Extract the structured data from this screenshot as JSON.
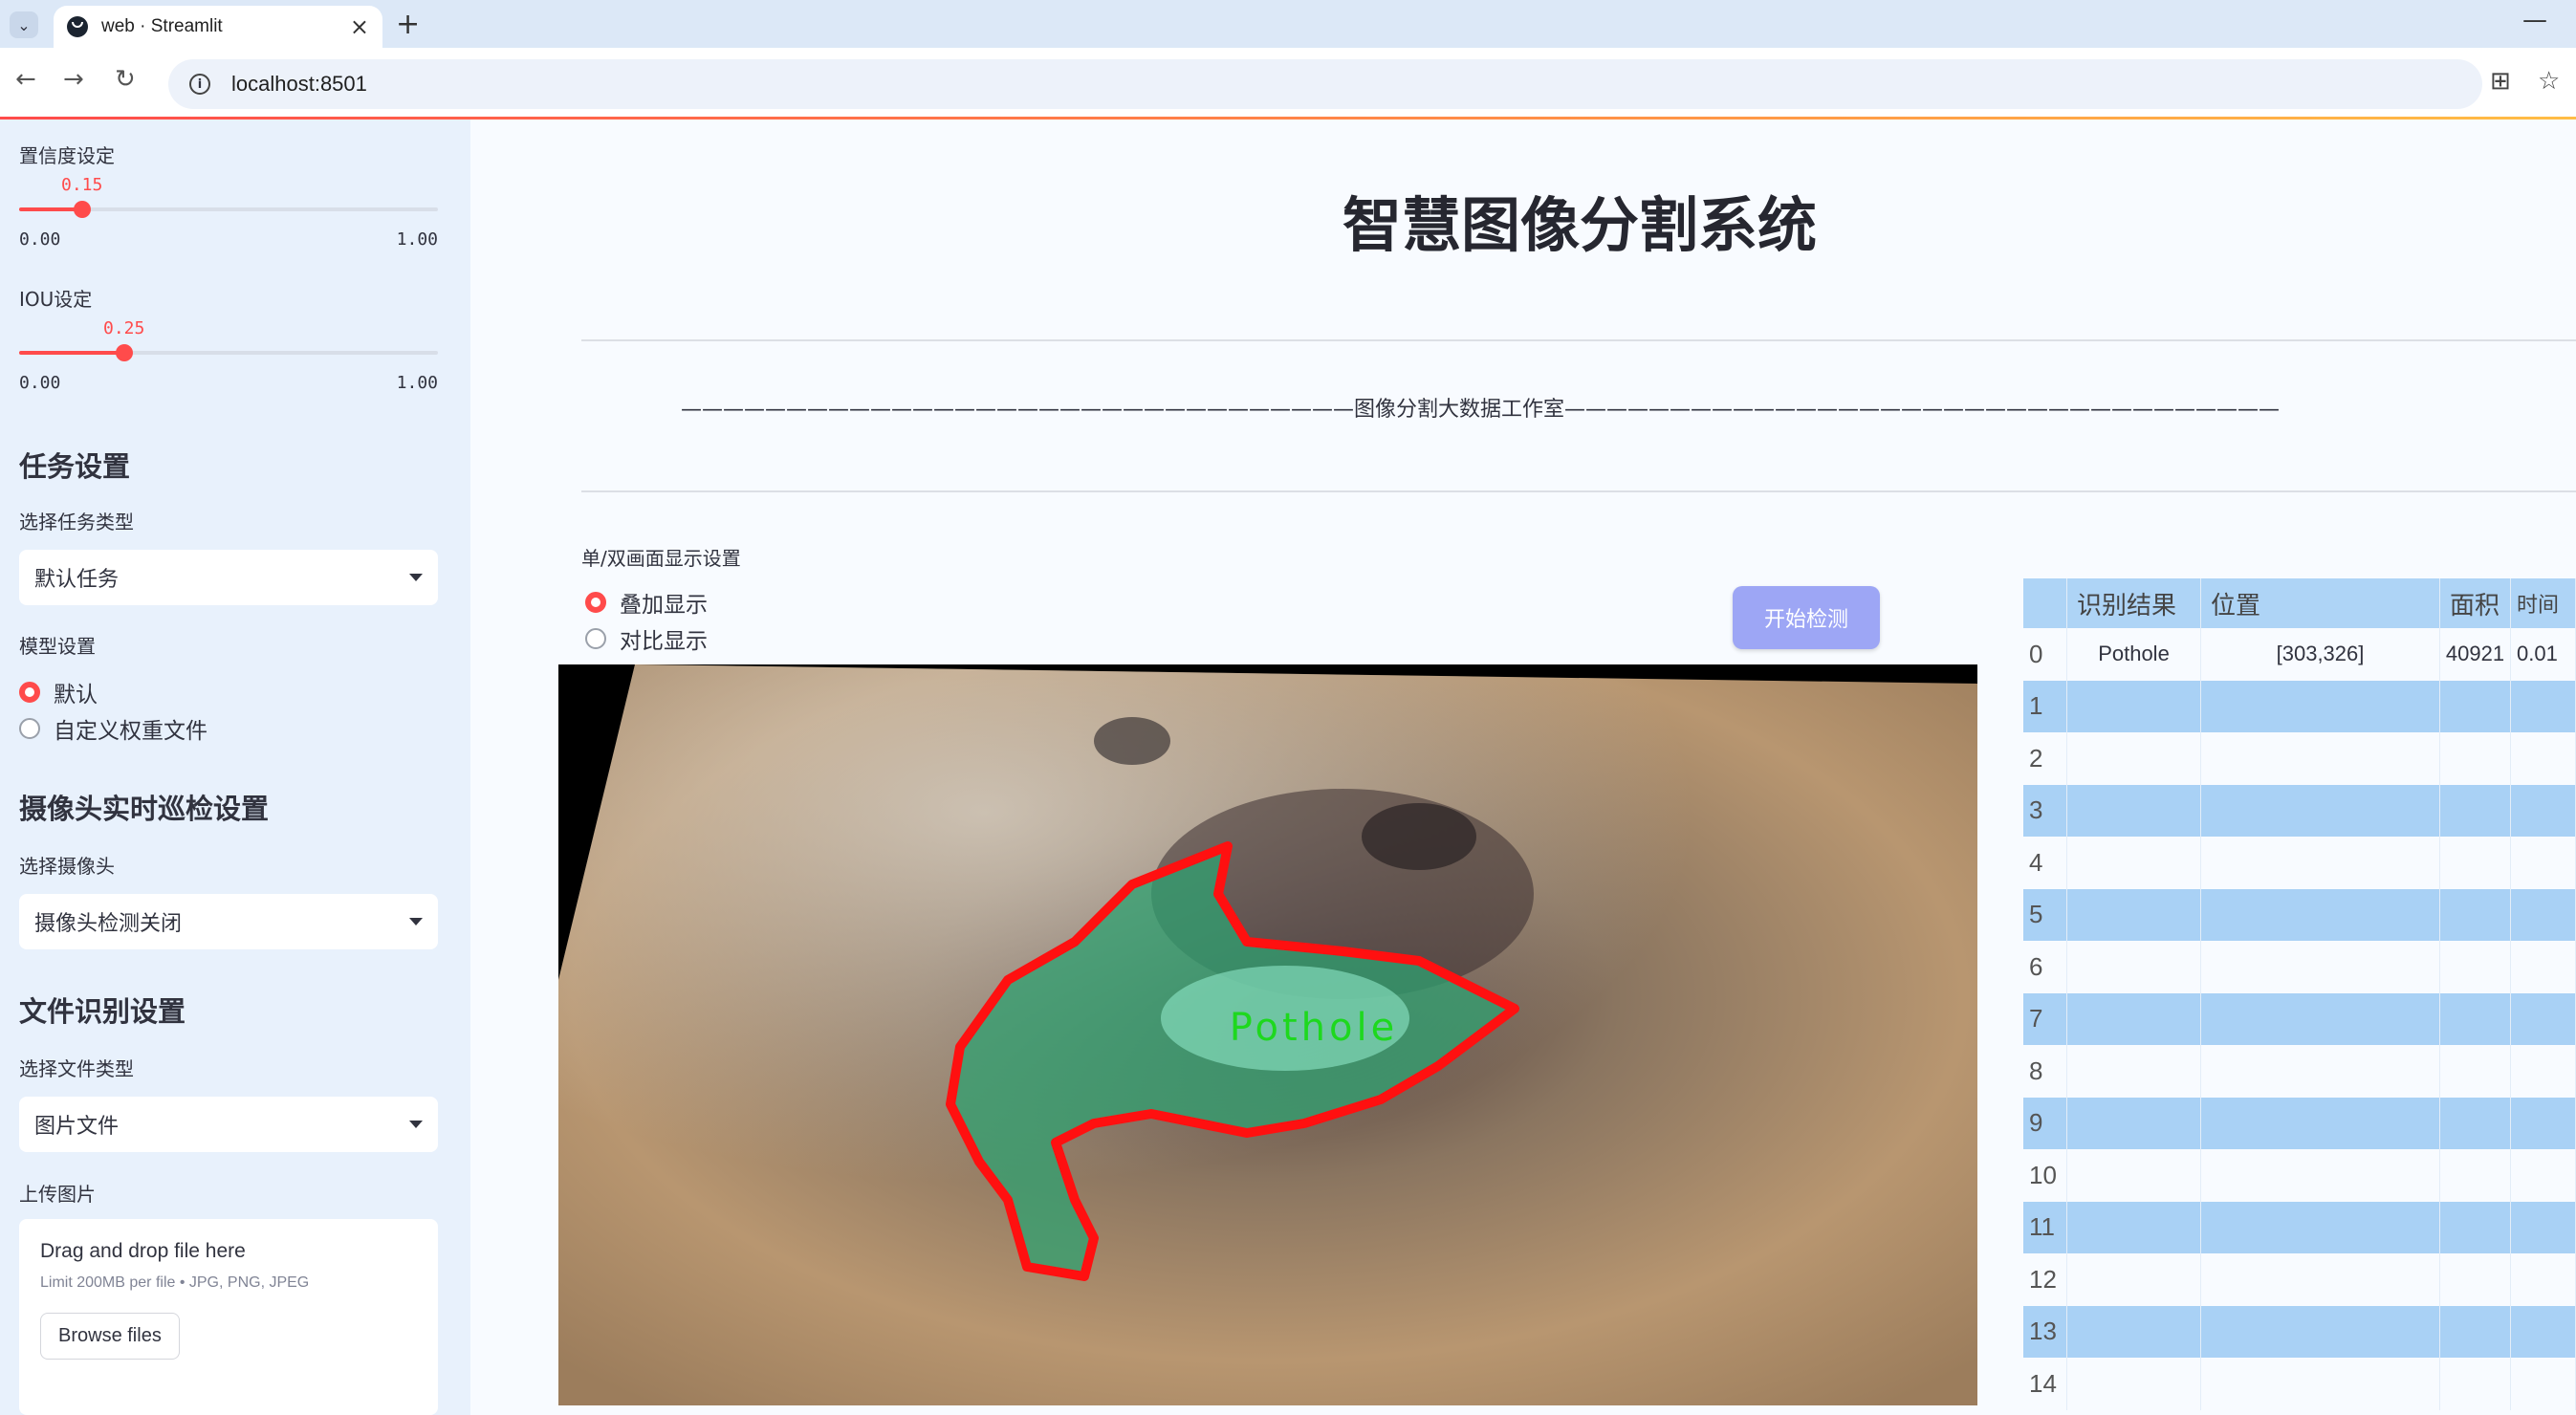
{
  "browser": {
    "tab_title": "web · Streamlit",
    "url": "localhost:8501",
    "new_tab": "+",
    "close_tab": "×",
    "minimize": "—"
  },
  "sidebar": {
    "confidence": {
      "label": "置信度设定",
      "value": "0.15",
      "min": "0.00",
      "max": "1.00",
      "fraction": 0.15
    },
    "iou": {
      "label": "IOU设定",
      "value": "0.25",
      "min": "0.00",
      "max": "1.00",
      "fraction": 0.25
    },
    "task_header": "任务设置",
    "task_type_label": "选择任务类型",
    "task_type_value": "默认任务",
    "model_label": "模型设置",
    "model_options": [
      "默认",
      "自定义权重文件"
    ],
    "camera_header": "摄像头实时巡检设置",
    "camera_label": "选择摄像头",
    "camera_value": "摄像头检测关闭",
    "file_header": "文件识别设置",
    "file_type_label": "选择文件类型",
    "file_type_value": "图片文件",
    "upload_label": "上传图片",
    "upload_title": "Drag and drop file here",
    "upload_limit": "Limit 200MB per file • JPG, PNG, JPEG",
    "browse_button": "Browse files"
  },
  "main": {
    "title": "智慧图像分割系统",
    "banner": "————————————————————————————————图像分割大数据工作室——————————————————————————————————",
    "display_label": "单/双画面显示设置",
    "display_options": [
      "叠加显示",
      "对比显示"
    ],
    "start_button": "开始检测",
    "detection_label": "Pothole"
  },
  "table": {
    "columns": [
      "",
      "识别结果",
      "位置",
      "面积",
      "时间"
    ],
    "rows": [
      [
        "0",
        "Pothole",
        "[303,326]",
        "40921",
        "0.01"
      ],
      [
        "1",
        "",
        "",
        "",
        ""
      ],
      [
        "2",
        "",
        "",
        "",
        ""
      ],
      [
        "3",
        "",
        "",
        "",
        ""
      ],
      [
        "4",
        "",
        "",
        "",
        ""
      ],
      [
        "5",
        "",
        "",
        "",
        ""
      ],
      [
        "6",
        "",
        "",
        "",
        ""
      ],
      [
        "7",
        "",
        "",
        "",
        ""
      ],
      [
        "8",
        "",
        "",
        "",
        ""
      ],
      [
        "9",
        "",
        "",
        "",
        ""
      ],
      [
        "10",
        "",
        "",
        "",
        ""
      ],
      [
        "11",
        "",
        "",
        "",
        ""
      ],
      [
        "12",
        "",
        "",
        "",
        ""
      ],
      [
        "13",
        "",
        "",
        "",
        ""
      ],
      [
        "14",
        "",
        "",
        "",
        ""
      ]
    ]
  },
  "colors": {
    "accent": "#ff4b4b",
    "sidebar_bg": "#e8f1fc",
    "table_stripe": "#a9d1f5",
    "button": "#9da6f5"
  }
}
